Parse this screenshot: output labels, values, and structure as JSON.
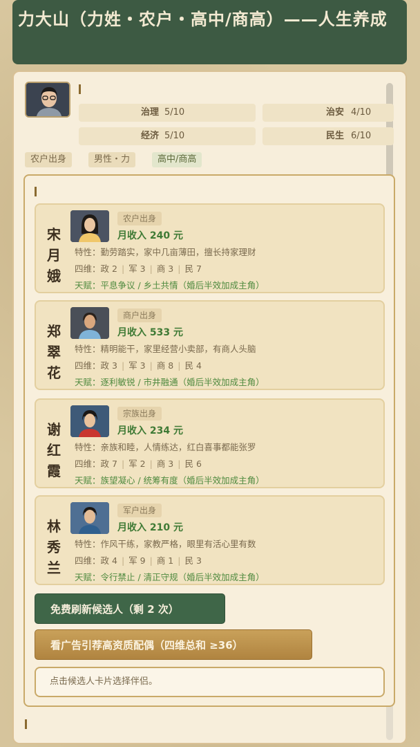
{
  "title": "力大山（力姓・农户・高中/商高）——人生养成",
  "player": {
    "stats": [
      {
        "label": "治理",
        "value": "5/10"
      },
      {
        "label": "治安",
        "value": "4/10"
      },
      {
        "label": "经济",
        "value": "5/10"
      },
      {
        "label": "民生",
        "value": "6/10"
      }
    ],
    "tags": [
      "农户出身",
      "男性・力",
      "高中/商高"
    ]
  },
  "candidates": [
    {
      "name_chars": [
        "宋",
        "月",
        "娥"
      ],
      "origin": "农户出身",
      "income": "月收入 240 元",
      "trait": "特性：勤劳踏实，家中几亩薄田，擅长持家理财",
      "stats_label": "四维：",
      "stats": [
        "政 2",
        "军 3",
        "商 3",
        "民 7"
      ],
      "talent": "天赋：平息争议 / 乡土共情（婚后半效加成主角）"
    },
    {
      "name_chars": [
        "郑",
        "翠",
        "花"
      ],
      "origin": "商户出身",
      "income": "月收入 533 元",
      "trait": "特性：精明能干，家里经营小卖部，有商人头脑",
      "stats_label": "四维：",
      "stats": [
        "政 3",
        "军 3",
        "商 8",
        "民 4"
      ],
      "talent": "天赋：逐利敏锐 / 市井融通（婚后半效加成主角）"
    },
    {
      "name_chars": [
        "谢",
        "红",
        "霞"
      ],
      "origin": "宗族出身",
      "income": "月收入 234 元",
      "trait": "特性：亲族和睦，人情练达，红白喜事都能张罗",
      "stats_label": "四维：",
      "stats": [
        "政 7",
        "军 2",
        "商 3",
        "民 6"
      ],
      "talent": "天赋：族望凝心 / 统筹有度（婚后半效加成主角）"
    },
    {
      "name_chars": [
        "林",
        "秀",
        "兰"
      ],
      "origin": "军户出身",
      "income": "月收入 210 元",
      "trait": "特性：作风干练，家教严格，眼里有活心里有数",
      "stats_label": "四维：",
      "stats": [
        "政 4",
        "军 9",
        "商 1",
        "民 3"
      ],
      "talent": "天赋：令行禁止 / 清正守规（婚后半效加成主角）"
    }
  ],
  "buttons": {
    "refresh": "免费刷新候选人（剩 2 次）",
    "ad": "看广告引荐高资质配偶（四维总和 ≥36）"
  },
  "hint": "点击候选人卡片选择伴侣。",
  "colors": {
    "header_bg": "#3d5a43",
    "income_green": "#3f7a35",
    "ad_gold": "#b08440"
  }
}
